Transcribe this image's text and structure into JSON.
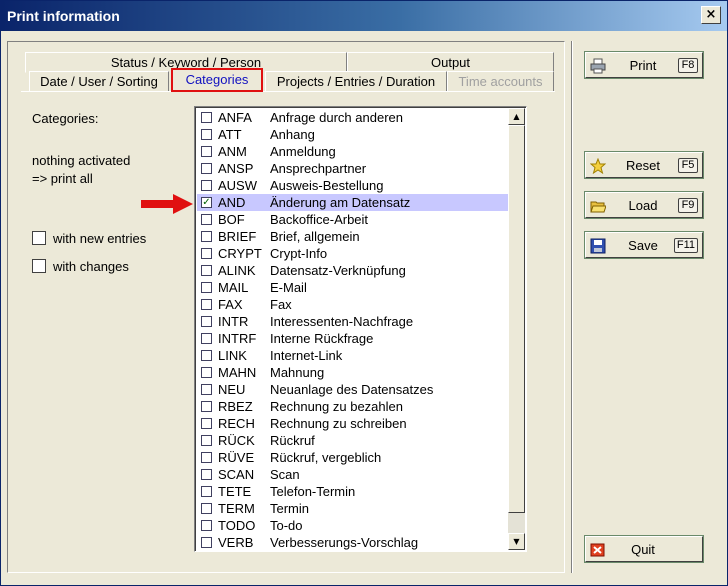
{
  "window": {
    "title": "Print information",
    "close_label": "×"
  },
  "tabs_row1": [
    {
      "label": "Status / Keyword / Person"
    },
    {
      "label": "Output"
    }
  ],
  "tabs_row2": [
    {
      "label": "Date / User / Sorting"
    },
    {
      "label": "Categories",
      "active": true
    },
    {
      "label": "Projects / Entries / Duration"
    },
    {
      "label": "Time accounts",
      "disabled": true
    }
  ],
  "categories_page": {
    "heading": "Categories:",
    "status_line1": "nothing activated",
    "status_line2": "=> print all",
    "with_new_entries_label": "with new entries",
    "with_changes_label": "with changes",
    "items": [
      {
        "code": "ANFA",
        "desc": "Anfrage durch anderen"
      },
      {
        "code": "ATT",
        "desc": "Anhang"
      },
      {
        "code": "ANM",
        "desc": "Anmeldung"
      },
      {
        "code": "ANSP",
        "desc": "Ansprechpartner"
      },
      {
        "code": "AUSW",
        "desc": "Ausweis-Bestellung"
      },
      {
        "code": "AND",
        "desc": "Änderung am Datensatz",
        "checked": true,
        "selected": true
      },
      {
        "code": "BOF",
        "desc": "Backoffice-Arbeit"
      },
      {
        "code": "BRIEF",
        "desc": "Brief, allgemein"
      },
      {
        "code": "CRYPT",
        "desc": "Crypt-Info"
      },
      {
        "code": "ALINK",
        "desc": "Datensatz-Verknüpfung"
      },
      {
        "code": "MAIL",
        "desc": "E-Mail"
      },
      {
        "code": "FAX",
        "desc": "Fax"
      },
      {
        "code": "INTR",
        "desc": "Interessenten-Nachfrage"
      },
      {
        "code": "INTRF",
        "desc": "Interne Rückfrage"
      },
      {
        "code": "LINK",
        "desc": "Internet-Link"
      },
      {
        "code": "MAHN",
        "desc": "Mahnung"
      },
      {
        "code": "NEU",
        "desc": "Neuanlage des Datensatzes"
      },
      {
        "code": "RBEZ",
        "desc": "Rechnung zu bezahlen"
      },
      {
        "code": "RECH",
        "desc": "Rechnung zu schreiben"
      },
      {
        "code": "RÜCK",
        "desc": "Rückruf"
      },
      {
        "code": "RÜVE",
        "desc": "Rückruf, vergeblich"
      },
      {
        "code": "SCAN",
        "desc": "Scan"
      },
      {
        "code": "TETE",
        "desc": "Telefon-Termin"
      },
      {
        "code": "TERM",
        "desc": "Termin"
      },
      {
        "code": "TODO",
        "desc": "To-do"
      },
      {
        "code": "VERB",
        "desc": "Verbesserungs-Vorschlag"
      }
    ]
  },
  "buttons": {
    "print": {
      "label": "Print",
      "key": "F8",
      "icon": "printer-icon"
    },
    "reset": {
      "label": "Reset",
      "key": "F5",
      "icon": "star-icon"
    },
    "load": {
      "label": "Load",
      "key": "F9",
      "icon": "folder-open-icon"
    },
    "save": {
      "label": "Save",
      "key": "F11",
      "icon": "floppy-disk-icon"
    },
    "quit": {
      "label": "Quit",
      "icon": "close-x-icon"
    }
  },
  "colors": {
    "selected_row": "#c8c8ff",
    "active_tab_border": "#e01010",
    "arrow": "#e01010"
  }
}
